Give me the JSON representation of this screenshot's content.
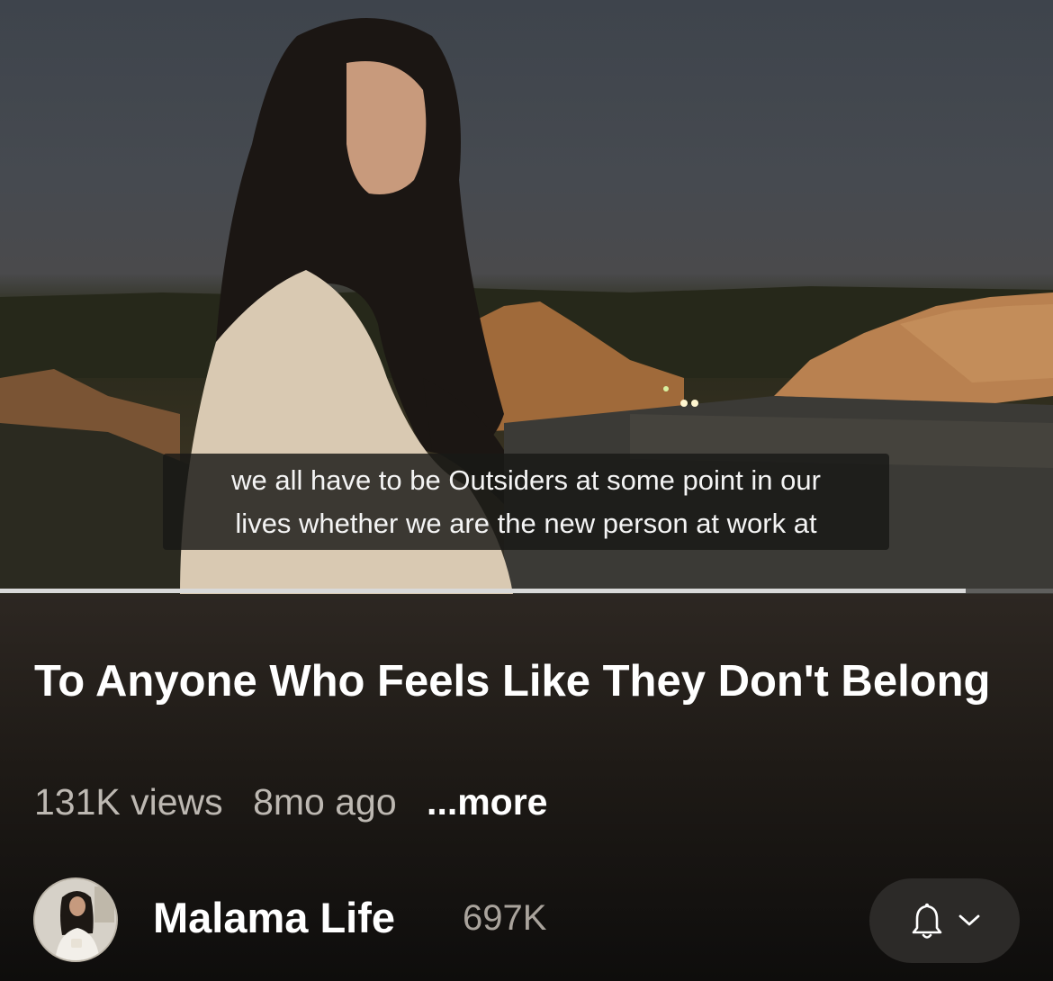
{
  "video": {
    "caption_lines": [
      "we all have to be Outsiders at some point in our",
      "lives whether we are the new person at work at"
    ],
    "progress": 0.917
  },
  "title": "To Anyone Who Feels Like They Don't Belong",
  "meta": {
    "views": "131K views",
    "age": "8mo ago",
    "more": "...more"
  },
  "channel": {
    "name": "Malama Life",
    "subscribers": "697K",
    "avatar_icon": "avatar",
    "subscribe_icons": [
      "bell-icon",
      "chevron-down-icon"
    ]
  }
}
